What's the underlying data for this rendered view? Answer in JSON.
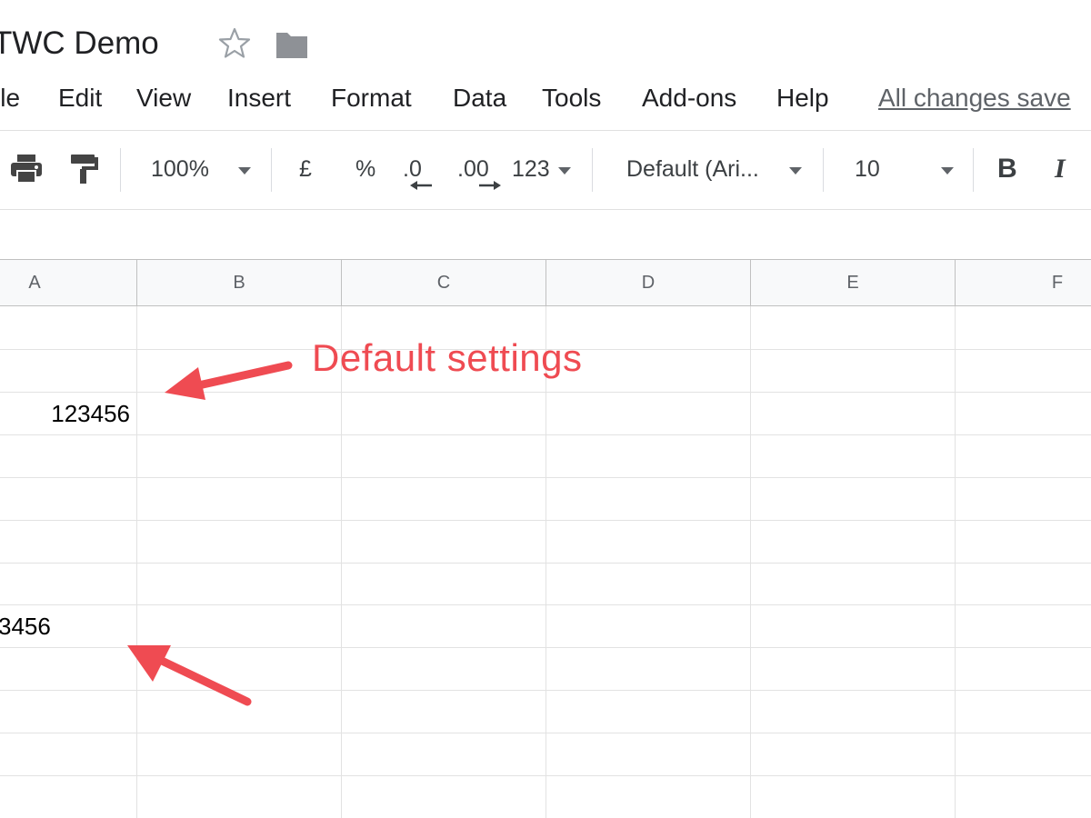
{
  "document": {
    "title": "TWC Demo"
  },
  "menu": {
    "items": [
      "ile",
      "Edit",
      "View",
      "Insert",
      "Format",
      "Data",
      "Tools",
      "Add-ons",
      "Help"
    ],
    "status": "All changes save"
  },
  "toolbar": {
    "zoom": "100%",
    "currency": "£",
    "percent": "%",
    "decrease_decimal": ".0",
    "increase_decimal": ".00",
    "more_formats": "123",
    "font": "Default (Ari...",
    "font_size": "10",
    "bold": "B",
    "italic": "I"
  },
  "grid": {
    "columns": [
      "A",
      "B",
      "C",
      "D",
      "E",
      "F"
    ],
    "cells": {
      "a3": "123456",
      "a8": "3456"
    }
  },
  "annotation": {
    "text": "Default settings"
  },
  "colors": {
    "annotation": "#ef4b52",
    "grid_line": "#e2e2e2",
    "header_bg": "#f8f9fa"
  }
}
